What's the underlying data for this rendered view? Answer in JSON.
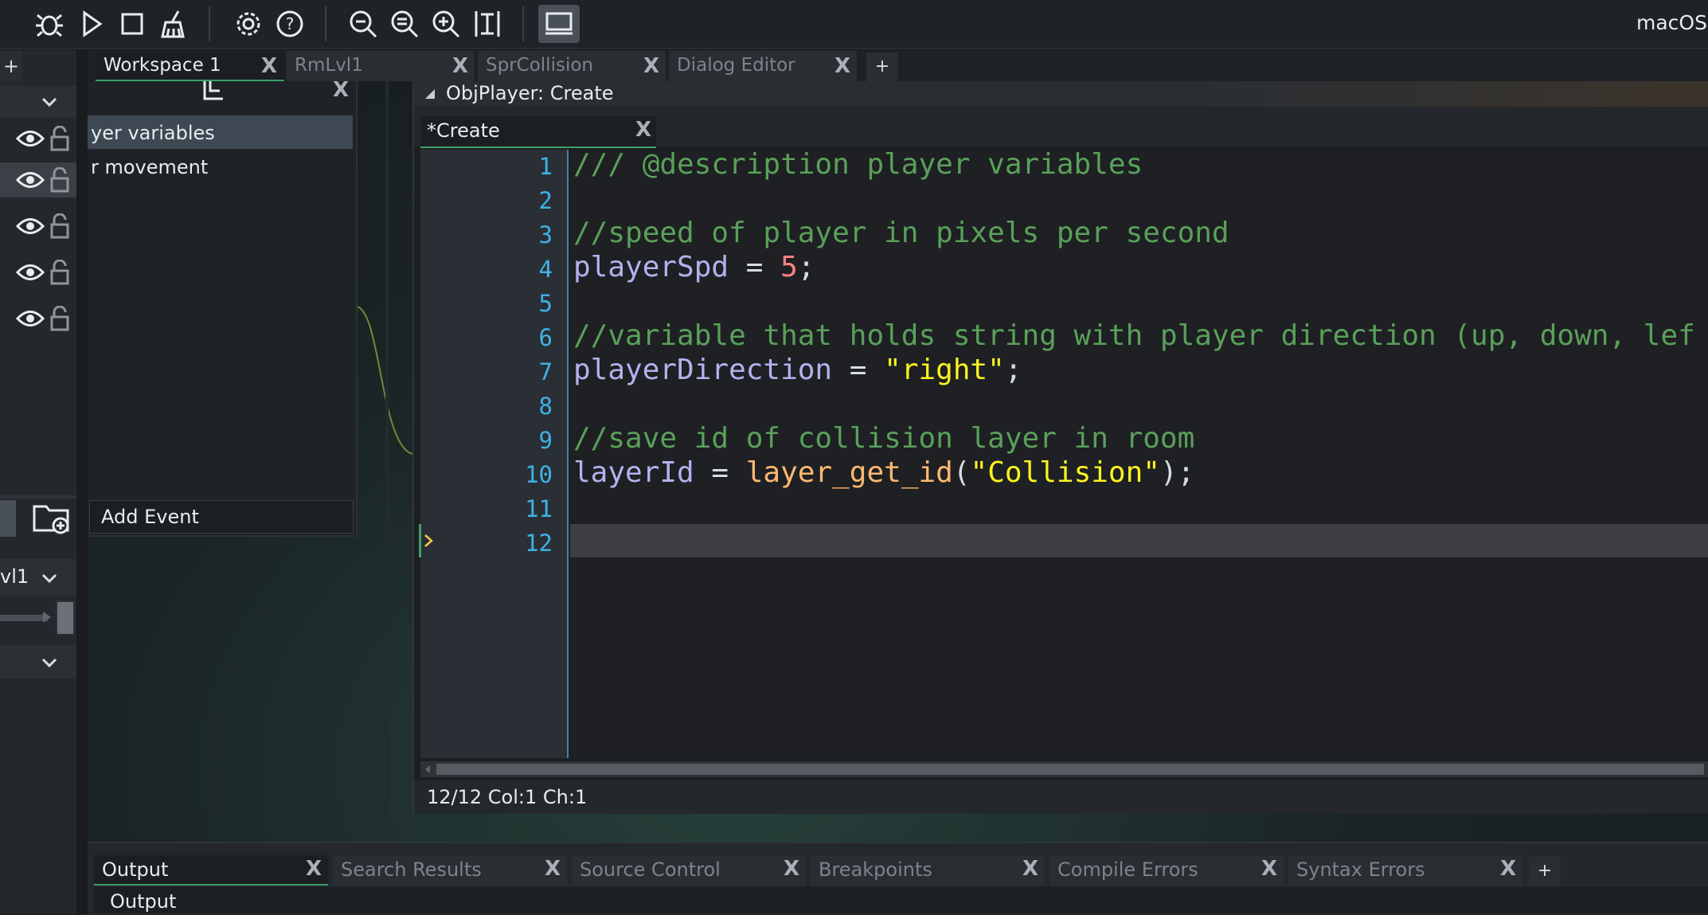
{
  "toolbar": {
    "icons": [
      "debug-icon",
      "run-icon",
      "stop-icon",
      "clean-icon",
      "settings-icon",
      "help-icon",
      "zoom-out-icon",
      "zoom-reset-icon",
      "zoom-in-icon",
      "fit-icon",
      "target-device-icon"
    ],
    "target_label": "macOS | Lo"
  },
  "workspace_tabs": [
    {
      "label": "Workspace 1",
      "close": "X"
    },
    {
      "label": "RmLvl1",
      "close": "X"
    },
    {
      "label": "SprCollision",
      "close": "X"
    },
    {
      "label": "Dialog Editor",
      "close": "X"
    }
  ],
  "workspace_add": "+",
  "left_panel": {
    "add_label": "+",
    "room_label": "vl1"
  },
  "events_panel": {
    "close": "X",
    "events": [
      {
        "label": "yer variables"
      },
      {
        "label": "r movement"
      }
    ],
    "add_event_label": "Add Event"
  },
  "code_window": {
    "title": "ObjPlayer: Create",
    "tab_label": "*Create",
    "tab_close": "X",
    "line_numbers": [
      "1",
      "2",
      "3",
      "4",
      "5",
      "6",
      "7",
      "8",
      "9",
      "10",
      "11",
      "12"
    ],
    "lines": {
      "l1": "/// @description player variables",
      "l3": "//speed of player in pixels per second",
      "l4_var": "playerSpd",
      "l4_op": " = ",
      "l4_num": "5",
      "l4_end": ";",
      "l6": "//variable that holds string with player direction (up, down, lef",
      "l7_var": "playerDirection",
      "l7_op": " = ",
      "l7_str": "\"right\"",
      "l7_end": ";",
      "l9": "//save id of collision layer in room",
      "l10_var": "layerId",
      "l10_op": " = ",
      "l10_fn": "layer_get_id",
      "l10_open": "(",
      "l10_str": "\"Collision\"",
      "l10_end": ");"
    },
    "status": "12/12 Col:1 Ch:1"
  },
  "bottom_tabs": [
    {
      "label": "Output",
      "close": "X"
    },
    {
      "label": "Search Results",
      "close": "X"
    },
    {
      "label": "Source Control",
      "close": "X"
    },
    {
      "label": "Breakpoints",
      "close": "X"
    },
    {
      "label": "Compile Errors",
      "close": "X"
    },
    {
      "label": "Syntax Errors",
      "close": "X"
    }
  ],
  "bottom_add": "+",
  "output_label": "Output",
  "colors": {
    "accent": "#3ea06a",
    "line_number": "#3fb1e6",
    "comment": "#5aa05a",
    "variable": "#b2b2ef",
    "string": "#fcf320",
    "number": "#ff8080",
    "function": "#ffb871"
  }
}
